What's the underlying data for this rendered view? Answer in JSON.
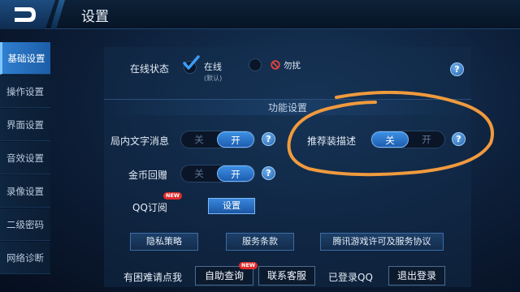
{
  "header": {
    "title": "设置",
    "back_icon": "back-arrow-icon"
  },
  "sidebar": {
    "items": [
      {
        "label": "基础设置",
        "active": true
      },
      {
        "label": "操作设置",
        "active": false
      },
      {
        "label": "界面设置",
        "active": false
      },
      {
        "label": "音效设置",
        "active": false
      },
      {
        "label": "录像设置",
        "active": false
      },
      {
        "label": "二级密码",
        "active": false
      },
      {
        "label": "网络诊断",
        "active": false
      }
    ]
  },
  "online_status": {
    "label": "在线状态",
    "online_label": "在线",
    "online_default": "(默认)",
    "dnd_label": "勿扰",
    "selected": "在线"
  },
  "section": {
    "title": "功能设置"
  },
  "toggles": {
    "in_game_text": {
      "label": "局内文字消息",
      "off": "关",
      "on": "开",
      "state": "开"
    },
    "gift": {
      "label": "金币回赠",
      "off": "关",
      "on": "开",
      "state": "开"
    },
    "recommend_desc": {
      "label": "推荐装描述",
      "off": "关",
      "on": "开",
      "state": "关"
    }
  },
  "qq_subscribe": {
    "label": "QQ订阅",
    "badge": "NEW",
    "button": "设置"
  },
  "links": {
    "privacy": "隐私策略",
    "terms": "服务条款",
    "license": "腾讯游戏许可及服务协议"
  },
  "footer": {
    "help_text": "有困难请点我",
    "self_help": "自助查询",
    "self_help_badge": "NEW",
    "contact": "联系客服",
    "login_status": "已登录QQ",
    "logout": "退出登录"
  },
  "colors": {
    "accent": "#2f7fd0",
    "annotation": "#f09a3e"
  }
}
